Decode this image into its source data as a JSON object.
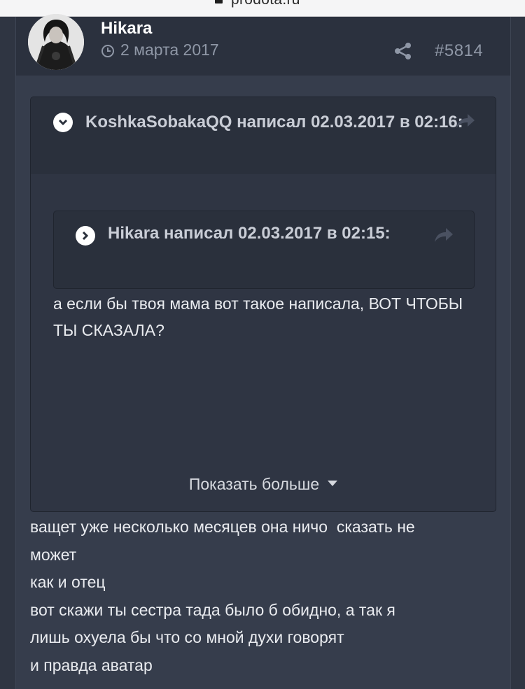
{
  "browser": {
    "url": "prodota.ru"
  },
  "post": {
    "author": "Hikara",
    "date": "2 марта 2017",
    "number": "#5814",
    "share_icon": "share-icon",
    "clock_icon": "clock-icon",
    "quote": {
      "title": "KoshkaSobakaQQ написал 02.03.2017 в 02:16:",
      "toggle_icon": "chevron-down-icon",
      "nested": {
        "title": "Hikara написал 02.03.2017 в 02:15:",
        "toggle_icon": "chevron-right-icon"
      },
      "text": "а если бы твоя мама вот такое написала, ВОТ ЧТОБЫ ТЫ СКАЗАЛА?",
      "show_more": "Показать больше"
    },
    "body_lines": [
      "ващет уже несколько месяцев она ничо  сказать не",
      "может",
      "как и отец",
      "вот скажи ты сестра тада было б обидно, а так я",
      "лишь охуела бы что со мной духи говорят",
      "и правда аватар"
    ]
  },
  "colors": {
    "background": "#2c3240",
    "post_bg": "#363d4c",
    "header_bg": "#2b313e",
    "quote_bg": "#2f3543",
    "muted_text": "#8f97a6",
    "text": "#e9ebef"
  }
}
